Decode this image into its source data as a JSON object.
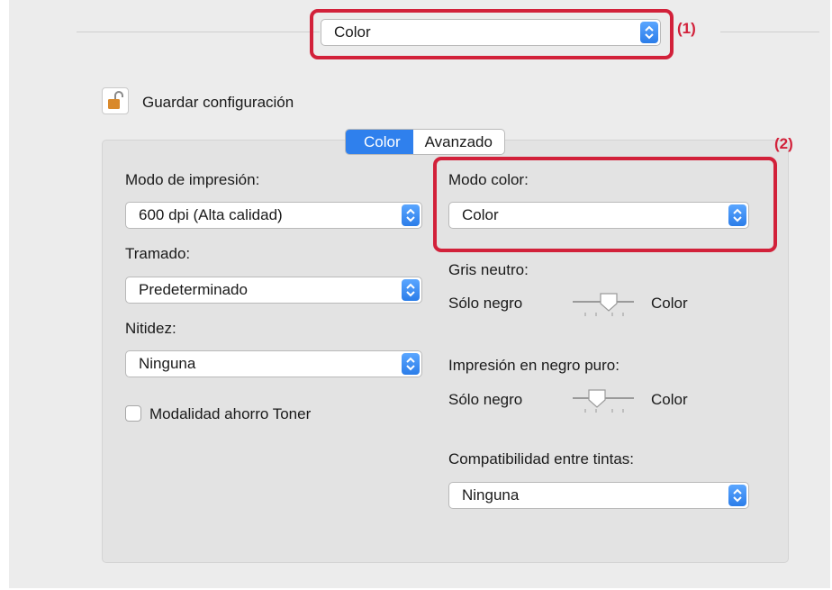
{
  "top_select": {
    "value": "Color",
    "marker": "(1)"
  },
  "save": {
    "label": "Guardar configuración",
    "icon": "lock-open-icon"
  },
  "tabs": [
    {
      "label": "Color",
      "active": true
    },
    {
      "label": "Avanzado",
      "active": false
    }
  ],
  "marker2": "(2)",
  "left": {
    "print_mode": {
      "label": "Modo de impresión:",
      "value": "600 dpi (Alta calidad)"
    },
    "halftone": {
      "label": "Tramado:",
      "value": "Predeterminado"
    },
    "sharpness": {
      "label": "Nitidez:",
      "value": "Ninguna"
    },
    "toner_saving": {
      "label": "Modalidad ahorro Toner",
      "checked": false
    }
  },
  "right": {
    "color_mode": {
      "label": "Modo color:",
      "value": "Color"
    },
    "neutral_gray": {
      "label": "Gris neutro:",
      "left": "Sólo negro",
      "right": "Color"
    },
    "pure_black": {
      "label": "Impresión en negro puro:",
      "left": "Sólo negro",
      "right": "Color"
    },
    "ink_compat": {
      "label": "Compatibilidad entre tintas:",
      "value": "Ninguna"
    }
  },
  "colors": {
    "accent": "#2f80ed",
    "highlight": "#d2213a",
    "panel": "#e3e3e3",
    "window": "#ececec"
  }
}
